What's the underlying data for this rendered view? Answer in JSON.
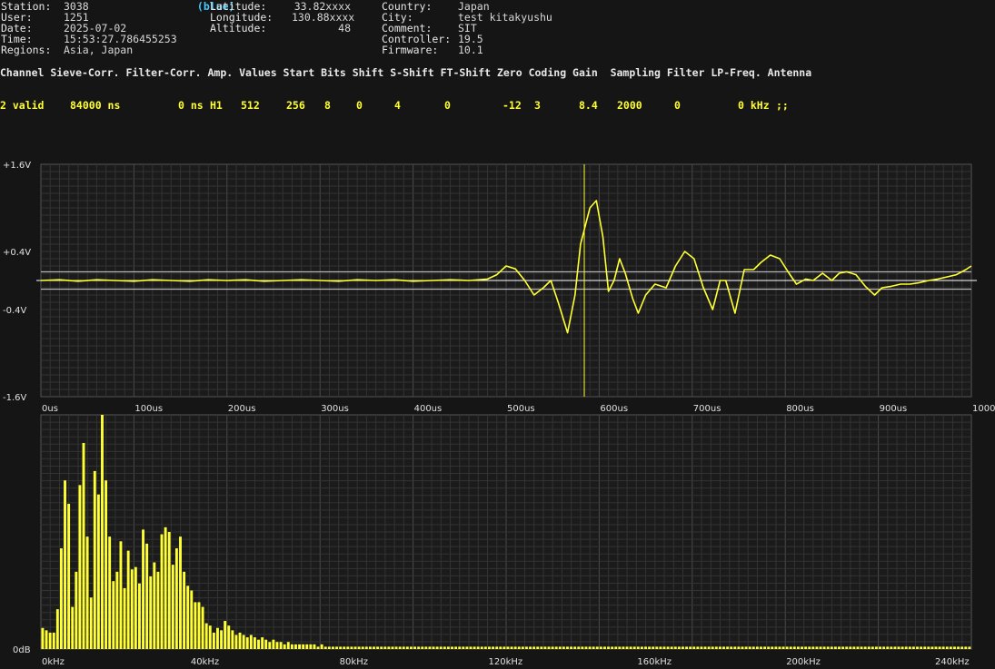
{
  "header": {
    "col1": [
      {
        "label": "Station:",
        "value": "3038",
        "extra": "(blue)"
      },
      {
        "label": "User:",
        "value": "1251"
      },
      {
        "label": "Date:",
        "value": "2025-07-02"
      },
      {
        "label": "Time:",
        "value": "15:53:27.786455253"
      },
      {
        "label": "Regions:",
        "value": "Asia, Japan"
      }
    ],
    "col2": [
      {
        "label": "Latitude:",
        "value": "33.82xxxx"
      },
      {
        "label": "Longitude:",
        "value": "130.88xxxx"
      },
      {
        "label": "Altitude:",
        "value": "48"
      }
    ],
    "col3": [
      {
        "label": "Country:",
        "value": "Japan"
      },
      {
        "label": "City:",
        "value": "test kitakyushu"
      },
      {
        "label": "Comment:",
        "value": "SIT"
      },
      {
        "label": "Controller:",
        "value": "19.5"
      },
      {
        "label": "Firmware:",
        "value": "10.1"
      }
    ]
  },
  "channel_table": {
    "headers": "Channel Sieve-Corr. Filter-Corr. Amp. Values Start Bits Shift S-Shift FT-Shift Zero Coding Gain  Sampling Filter LP-Freq. Antenna",
    "row": [
      "2 valid",
      "84000 ns",
      "0 ns",
      "H1",
      "512",
      "256",
      "8",
      "0",
      "4",
      "0",
      "-12",
      "3",
      "8.4",
      "2000",
      "0",
      "0 kHz",
      ";;"
    ]
  },
  "waveform": {
    "y_labels": [
      "+1.6V",
      "+0.4V",
      "-0.4V",
      "-1.6V"
    ],
    "x_labels": [
      "0us",
      "100us",
      "200us",
      "300us",
      "400us",
      "500us",
      "600us",
      "700us",
      "800us",
      "900us",
      "1000us"
    ],
    "ylim": [
      -1.6,
      1.6
    ],
    "xlim": [
      0,
      1000
    ],
    "threshold_upper": 0.12,
    "threshold_lower": -0.12,
    "trigger_us": 584,
    "line_color": "#ffff33",
    "points": [
      [
        0,
        0.0
      ],
      [
        20,
        0.01
      ],
      [
        40,
        -0.01
      ],
      [
        60,
        0.01
      ],
      [
        80,
        0.0
      ],
      [
        100,
        -0.01
      ],
      [
        120,
        0.01
      ],
      [
        140,
        0.0
      ],
      [
        160,
        -0.01
      ],
      [
        180,
        0.01
      ],
      [
        200,
        0.0
      ],
      [
        220,
        0.01
      ],
      [
        240,
        -0.01
      ],
      [
        260,
        0.0
      ],
      [
        280,
        0.01
      ],
      [
        300,
        0.0
      ],
      [
        320,
        -0.01
      ],
      [
        340,
        0.01
      ],
      [
        360,
        0.0
      ],
      [
        380,
        0.01
      ],
      [
        400,
        -0.01
      ],
      [
        420,
        0.0
      ],
      [
        440,
        0.01
      ],
      [
        460,
        0.0
      ],
      [
        480,
        0.02
      ],
      [
        490,
        0.08
      ],
      [
        500,
        0.2
      ],
      [
        510,
        0.16
      ],
      [
        520,
        0.0
      ],
      [
        530,
        -0.2
      ],
      [
        540,
        -0.1
      ],
      [
        548,
        0.0
      ],
      [
        556,
        -0.3
      ],
      [
        566,
        -0.72
      ],
      [
        574,
        -0.2
      ],
      [
        580,
        0.5
      ],
      [
        590,
        1.0
      ],
      [
        597,
        1.1
      ],
      [
        604,
        0.6
      ],
      [
        610,
        -0.15
      ],
      [
        616,
        0.0
      ],
      [
        622,
        0.3
      ],
      [
        628,
        0.1
      ],
      [
        636,
        -0.25
      ],
      [
        642,
        -0.45
      ],
      [
        650,
        -0.2
      ],
      [
        660,
        -0.05
      ],
      [
        672,
        -0.1
      ],
      [
        682,
        0.2
      ],
      [
        692,
        0.4
      ],
      [
        702,
        0.3
      ],
      [
        712,
        -0.1
      ],
      [
        722,
        -0.4
      ],
      [
        730,
        0.0
      ],
      [
        736,
        0.0
      ],
      [
        746,
        -0.45
      ],
      [
        756,
        0.15
      ],
      [
        766,
        0.15
      ],
      [
        774,
        0.25
      ],
      [
        784,
        0.35
      ],
      [
        794,
        0.3
      ],
      [
        804,
        0.1
      ],
      [
        812,
        -0.05
      ],
      [
        822,
        0.02
      ],
      [
        830,
        0.0
      ],
      [
        840,
        0.1
      ],
      [
        850,
        0.0
      ],
      [
        858,
        0.1
      ],
      [
        866,
        0.12
      ],
      [
        876,
        0.08
      ],
      [
        886,
        -0.08
      ],
      [
        896,
        -0.2
      ],
      [
        904,
        -0.1
      ],
      [
        914,
        -0.08
      ],
      [
        924,
        -0.05
      ],
      [
        934,
        -0.05
      ],
      [
        944,
        -0.03
      ],
      [
        954,
        0.0
      ],
      [
        964,
        0.02
      ],
      [
        974,
        0.05
      ],
      [
        984,
        0.08
      ],
      [
        994,
        0.15
      ],
      [
        1000,
        0.2
      ]
    ]
  },
  "spectrum": {
    "y_labels": [
      "0dB"
    ],
    "x_labels": [
      "0kHz",
      "40kHz",
      "80kHz",
      "120kHz",
      "160kHz",
      "200kHz",
      "240kHz"
    ],
    "xlim": [
      0,
      250
    ],
    "bar_color": "#ffff33",
    "bars": [
      [
        0,
        0.09
      ],
      [
        1,
        0.08
      ],
      [
        2,
        0.07
      ],
      [
        3,
        0.07
      ],
      [
        4,
        0.17
      ],
      [
        5,
        0.43
      ],
      [
        6,
        0.72
      ],
      [
        7,
        0.62
      ],
      [
        8,
        0.18
      ],
      [
        9,
        0.33
      ],
      [
        10,
        0.7
      ],
      [
        11,
        0.88
      ],
      [
        12,
        0.48
      ],
      [
        13,
        0.22
      ],
      [
        14,
        0.76
      ],
      [
        15,
        0.66
      ],
      [
        16,
        1.0
      ],
      [
        17,
        0.72
      ],
      [
        18,
        0.48
      ],
      [
        19,
        0.29
      ],
      [
        20,
        0.33
      ],
      [
        21,
        0.46
      ],
      [
        22,
        0.26
      ],
      [
        23,
        0.42
      ],
      [
        24,
        0.34
      ],
      [
        25,
        0.35
      ],
      [
        26,
        0.28
      ],
      [
        27,
        0.51
      ],
      [
        28,
        0.45
      ],
      [
        29,
        0.31
      ],
      [
        30,
        0.37
      ],
      [
        31,
        0.33
      ],
      [
        32,
        0.49
      ],
      [
        33,
        0.52
      ],
      [
        34,
        0.5
      ],
      [
        35,
        0.36
      ],
      [
        36,
        0.43
      ],
      [
        37,
        0.48
      ],
      [
        38,
        0.33
      ],
      [
        39,
        0.27
      ],
      [
        40,
        0.25
      ],
      [
        41,
        0.2
      ],
      [
        42,
        0.2
      ],
      [
        43,
        0.18
      ],
      [
        44,
        0.11
      ],
      [
        45,
        0.1
      ],
      [
        46,
        0.07
      ],
      [
        47,
        0.09
      ],
      [
        48,
        0.08
      ],
      [
        49,
        0.12
      ],
      [
        50,
        0.1
      ],
      [
        51,
        0.08
      ],
      [
        52,
        0.06
      ],
      [
        53,
        0.07
      ],
      [
        54,
        0.06
      ],
      [
        55,
        0.05
      ],
      [
        56,
        0.06
      ],
      [
        57,
        0.05
      ],
      [
        58,
        0.04
      ],
      [
        59,
        0.05
      ],
      [
        60,
        0.04
      ],
      [
        61,
        0.03
      ],
      [
        62,
        0.04
      ],
      [
        63,
        0.03
      ],
      [
        64,
        0.03
      ],
      [
        65,
        0.02
      ],
      [
        66,
        0.03
      ],
      [
        67,
        0.02
      ],
      [
        68,
        0.02
      ],
      [
        69,
        0.02
      ],
      [
        70,
        0.02
      ],
      [
        71,
        0.02
      ],
      [
        72,
        0.02
      ],
      [
        73,
        0.02
      ],
      [
        74,
        0.01
      ],
      [
        75,
        0.02
      ],
      [
        76,
        0.01
      ],
      [
        77,
        0.01
      ],
      [
        78,
        0.01
      ],
      [
        79,
        0.01
      ],
      [
        80,
        0.01
      ],
      [
        81,
        0.01
      ],
      [
        82,
        0.01
      ],
      [
        83,
        0.01
      ],
      [
        84,
        0.01
      ],
      [
        85,
        0.01
      ],
      [
        86,
        0.01
      ],
      [
        87,
        0.01
      ],
      [
        88,
        0.01
      ],
      [
        89,
        0.01
      ],
      [
        90,
        0.01
      ],
      [
        91,
        0.01
      ],
      [
        92,
        0.01
      ],
      [
        93,
        0.01
      ],
      [
        94,
        0.01
      ],
      [
        95,
        0.01
      ],
      [
        96,
        0.01
      ],
      [
        97,
        0.01
      ],
      [
        98,
        0.01
      ],
      [
        99,
        0.01
      ],
      [
        100,
        0.01
      ],
      [
        101,
        0.01
      ],
      [
        102,
        0.01
      ],
      [
        103,
        0.01
      ],
      [
        104,
        0.01
      ],
      [
        105,
        0.01
      ],
      [
        106,
        0.01
      ],
      [
        107,
        0.01
      ],
      [
        108,
        0.01
      ],
      [
        109,
        0.01
      ],
      [
        110,
        0.01
      ],
      [
        111,
        0.01
      ],
      [
        112,
        0.01
      ],
      [
        113,
        0.01
      ],
      [
        114,
        0.01
      ],
      [
        115,
        0.01
      ],
      [
        116,
        0.01
      ],
      [
        117,
        0.01
      ],
      [
        118,
        0.01
      ],
      [
        119,
        0.01
      ],
      [
        120,
        0.01
      ],
      [
        121,
        0.01
      ],
      [
        122,
        0.01
      ],
      [
        123,
        0.01
      ],
      [
        124,
        0.01
      ],
      [
        125,
        0.01
      ],
      [
        126,
        0.01
      ],
      [
        127,
        0.01
      ],
      [
        128,
        0.01
      ],
      [
        129,
        0.01
      ],
      [
        130,
        0.01
      ],
      [
        131,
        0.01
      ],
      [
        132,
        0.01
      ],
      [
        133,
        0.01
      ],
      [
        134,
        0.01
      ],
      [
        135,
        0.01
      ],
      [
        136,
        0.01
      ],
      [
        137,
        0.01
      ],
      [
        138,
        0.01
      ],
      [
        139,
        0.01
      ],
      [
        140,
        0.01
      ],
      [
        141,
        0.01
      ],
      [
        142,
        0.01
      ],
      [
        143,
        0.01
      ],
      [
        144,
        0.01
      ],
      [
        145,
        0.01
      ],
      [
        146,
        0.01
      ],
      [
        147,
        0.01
      ],
      [
        148,
        0.01
      ],
      [
        149,
        0.01
      ],
      [
        150,
        0.01
      ],
      [
        151,
        0.01
      ],
      [
        152,
        0.01
      ],
      [
        153,
        0.01
      ],
      [
        154,
        0.01
      ],
      [
        155,
        0.01
      ],
      [
        156,
        0.01
      ],
      [
        157,
        0.01
      ],
      [
        158,
        0.01
      ],
      [
        159,
        0.01
      ],
      [
        160,
        0.01
      ],
      [
        161,
        0.01
      ],
      [
        162,
        0.01
      ],
      [
        163,
        0.01
      ],
      [
        164,
        0.01
      ],
      [
        165,
        0.01
      ],
      [
        166,
        0.01
      ],
      [
        167,
        0.01
      ],
      [
        168,
        0.01
      ],
      [
        169,
        0.01
      ],
      [
        170,
        0.01
      ],
      [
        171,
        0.01
      ],
      [
        172,
        0.01
      ],
      [
        173,
        0.01
      ],
      [
        174,
        0.01
      ],
      [
        175,
        0.01
      ],
      [
        176,
        0.01
      ],
      [
        177,
        0.01
      ],
      [
        178,
        0.01
      ],
      [
        179,
        0.01
      ],
      [
        180,
        0.01
      ],
      [
        181,
        0.01
      ],
      [
        182,
        0.01
      ],
      [
        183,
        0.01
      ],
      [
        184,
        0.01
      ],
      [
        185,
        0.01
      ],
      [
        186,
        0.01
      ],
      [
        187,
        0.01
      ],
      [
        188,
        0.01
      ],
      [
        189,
        0.01
      ],
      [
        190,
        0.01
      ],
      [
        191,
        0.01
      ],
      [
        192,
        0.01
      ],
      [
        193,
        0.01
      ],
      [
        194,
        0.01
      ],
      [
        195,
        0.01
      ],
      [
        196,
        0.01
      ],
      [
        197,
        0.01
      ],
      [
        198,
        0.01
      ],
      [
        199,
        0.01
      ],
      [
        200,
        0.01
      ],
      [
        201,
        0.01
      ],
      [
        202,
        0.01
      ],
      [
        203,
        0.01
      ],
      [
        204,
        0.01
      ],
      [
        205,
        0.01
      ],
      [
        206,
        0.01
      ],
      [
        207,
        0.01
      ],
      [
        208,
        0.01
      ],
      [
        209,
        0.01
      ],
      [
        210,
        0.01
      ],
      [
        211,
        0.01
      ],
      [
        212,
        0.01
      ],
      [
        213,
        0.01
      ],
      [
        214,
        0.01
      ],
      [
        215,
        0.01
      ],
      [
        216,
        0.01
      ],
      [
        217,
        0.01
      ],
      [
        218,
        0.01
      ],
      [
        219,
        0.01
      ],
      [
        220,
        0.01
      ],
      [
        221,
        0.01
      ],
      [
        222,
        0.01
      ],
      [
        223,
        0.01
      ],
      [
        224,
        0.01
      ],
      [
        225,
        0.01
      ],
      [
        226,
        0.01
      ],
      [
        227,
        0.01
      ],
      [
        228,
        0.01
      ],
      [
        229,
        0.01
      ],
      [
        230,
        0.01
      ],
      [
        231,
        0.01
      ],
      [
        232,
        0.01
      ],
      [
        233,
        0.01
      ],
      [
        234,
        0.01
      ],
      [
        235,
        0.01
      ],
      [
        236,
        0.01
      ],
      [
        237,
        0.01
      ],
      [
        238,
        0.01
      ],
      [
        239,
        0.01
      ],
      [
        240,
        0.01
      ],
      [
        241,
        0.01
      ],
      [
        242,
        0.01
      ],
      [
        243,
        0.01
      ],
      [
        244,
        0.01
      ],
      [
        245,
        0.01
      ],
      [
        246,
        0.01
      ],
      [
        247,
        0.01
      ],
      [
        248,
        0.01
      ],
      [
        249,
        0.01
      ]
    ]
  },
  "chart_data": [
    {
      "type": "line",
      "xlim": [
        0,
        1000
      ],
      "ylim": [
        -1.6,
        1.6
      ],
      "tick_labels_x": [
        "0us",
        "100us",
        "200us",
        "300us",
        "400us",
        "500us",
        "600us",
        "700us",
        "800us",
        "900us",
        "1000us"
      ],
      "tick_labels_y": [
        "+1.6V",
        "+0.4V",
        "-0.4V",
        "-1.6V"
      ],
      "grid": true
    },
    {
      "type": "bar",
      "xlim": [
        0,
        250
      ],
      "tick_labels_x": [
        "0kHz",
        "40kHz",
        "80kHz",
        "120kHz",
        "160kHz",
        "200kHz",
        "240kHz"
      ],
      "tick_labels_y": [
        "0dB"
      ],
      "grid": true
    }
  ]
}
